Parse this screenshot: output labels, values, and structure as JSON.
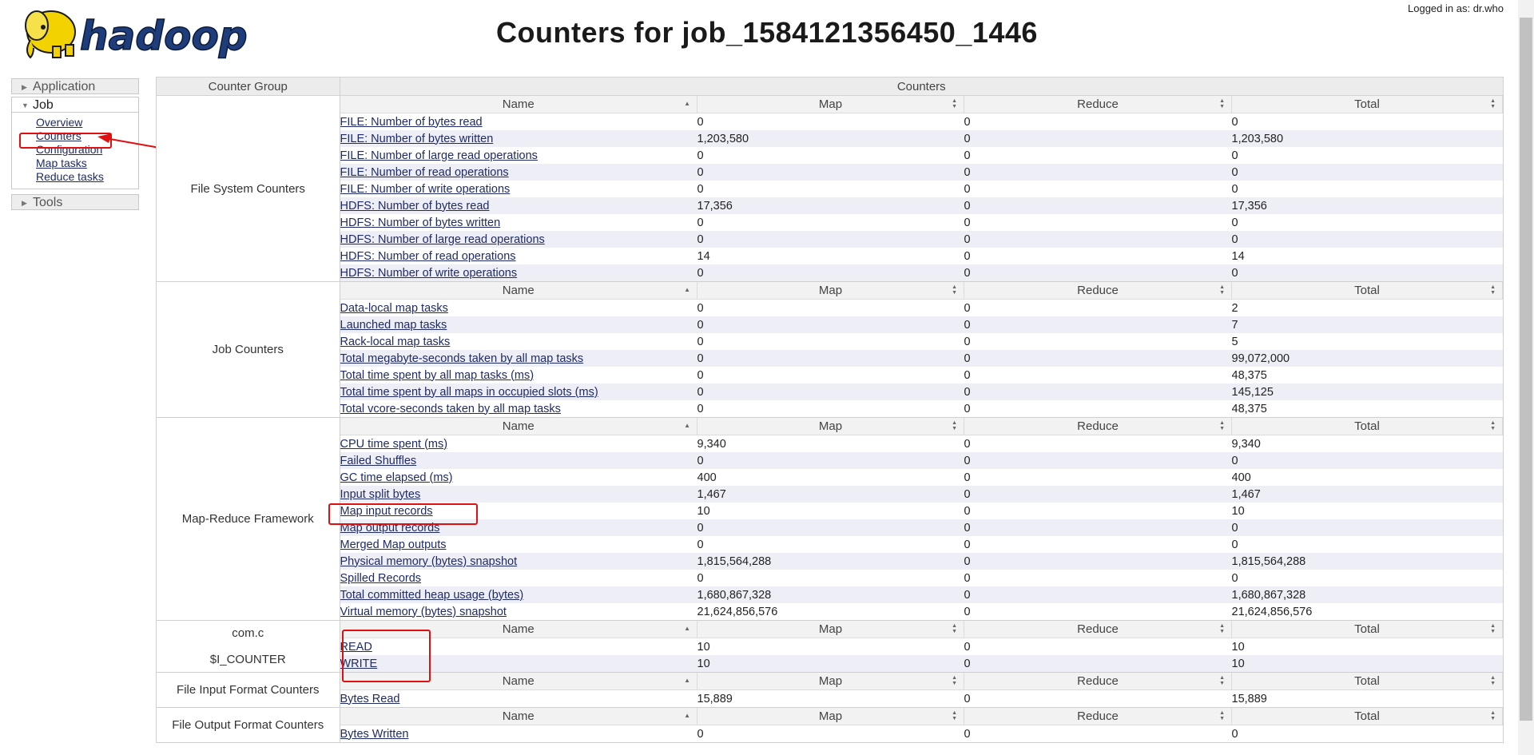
{
  "header": {
    "logo_text": "hadoop",
    "title": "Counters for job_1584121356450_1446",
    "login": "Logged in as: dr.who"
  },
  "sidebar": {
    "application": "Application",
    "job": "Job",
    "job_links": [
      "Overview",
      "Counters",
      "Configuration",
      "Map tasks",
      "Reduce tasks"
    ],
    "tools": "Tools"
  },
  "table": {
    "col_group": "Counter Group",
    "col_counters": "Counters",
    "sub_headers": [
      "Name",
      "Map",
      "Reduce",
      "Total"
    ],
    "groups": [
      {
        "name": "File System Counters",
        "rows": [
          [
            "FILE: Number of bytes read",
            "0",
            "0",
            "0"
          ],
          [
            "FILE: Number of bytes written",
            "1,203,580",
            "0",
            "1,203,580"
          ],
          [
            "FILE: Number of large read operations",
            "0",
            "0",
            "0"
          ],
          [
            "FILE: Number of read operations",
            "0",
            "0",
            "0"
          ],
          [
            "FILE: Number of write operations",
            "0",
            "0",
            "0"
          ],
          [
            "HDFS: Number of bytes read",
            "17,356",
            "0",
            "17,356"
          ],
          [
            "HDFS: Number of bytes written",
            "0",
            "0",
            "0"
          ],
          [
            "HDFS: Number of large read operations",
            "0",
            "0",
            "0"
          ],
          [
            "HDFS: Number of read operations",
            "14",
            "0",
            "14"
          ],
          [
            "HDFS: Number of write operations",
            "0",
            "0",
            "0"
          ]
        ]
      },
      {
        "name": "Job Counters",
        "rows": [
          [
            "Data-local map tasks",
            "0",
            "0",
            "2"
          ],
          [
            "Launched map tasks",
            "0",
            "0",
            "7"
          ],
          [
            "Rack-local map tasks",
            "0",
            "0",
            "5"
          ],
          [
            "Total megabyte-seconds taken by all map tasks",
            "0",
            "0",
            "99,072,000"
          ],
          [
            "Total time spent by all map tasks (ms)",
            "0",
            "0",
            "48,375"
          ],
          [
            "Total time spent by all maps in occupied slots (ms)",
            "0",
            "0",
            "145,125"
          ],
          [
            "Total vcore-seconds taken by all map tasks",
            "0",
            "0",
            "48,375"
          ]
        ]
      },
      {
        "name": "Map-Reduce Framework",
        "rows": [
          [
            "CPU time spent (ms)",
            "9,340",
            "0",
            "9,340"
          ],
          [
            "Failed Shuffles",
            "0",
            "0",
            "0"
          ],
          [
            "GC time elapsed (ms)",
            "400",
            "0",
            "400"
          ],
          [
            "Input split bytes",
            "1,467",
            "0",
            "1,467"
          ],
          [
            "Map input records",
            "10",
            "0",
            "10"
          ],
          [
            "Map output records",
            "0",
            "0",
            "0"
          ],
          [
            "Merged Map outputs",
            "0",
            "0",
            "0"
          ],
          [
            "Physical memory (bytes) snapshot",
            "1,815,564,288",
            "0",
            "1,815,564,288"
          ],
          [
            "Spilled Records",
            "0",
            "0",
            "0"
          ],
          [
            "Total committed heap usage (bytes)",
            "1,680,867,328",
            "0",
            "1,680,867,328"
          ],
          [
            "Virtual memory (bytes) snapshot",
            "21,624,856,576",
            "0",
            "21,624,856,576"
          ]
        ]
      },
      {
        "name_lines": [
          "com.c",
          "",
          "$I_COUNTER"
        ],
        "rows": [
          [
            "READ",
            "10",
            "0",
            "10"
          ],
          [
            "WRITE",
            "10",
            "0",
            "10"
          ]
        ]
      },
      {
        "name": "File Input Format Counters",
        "rows": [
          [
            "Bytes Read",
            "15,889",
            "0",
            "15,889"
          ]
        ]
      },
      {
        "name": "File Output Format Counters",
        "rows": [
          [
            "Bytes Written",
            "0",
            "0",
            "0"
          ]
        ]
      }
    ]
  },
  "colors": {
    "annotation": "#e01010",
    "link": "#1f2b66",
    "row_alt": "#eeeef7",
    "logo_fill": "#1e3d7a",
    "elephant": "#f2d200"
  }
}
